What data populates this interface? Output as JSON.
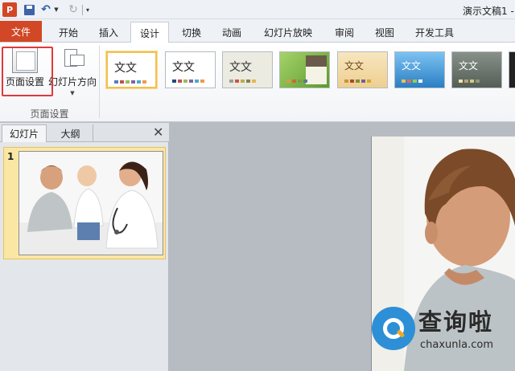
{
  "app": {
    "logo_letter": "P",
    "document_title": "演示文稿1 -"
  },
  "quick_access": {
    "save": "save-icon",
    "undo": "undo-icon",
    "redo": "redo-icon"
  },
  "tabs": {
    "file": "文件",
    "items": [
      {
        "label": "开始"
      },
      {
        "label": "插入"
      },
      {
        "label": "设计",
        "active": true
      },
      {
        "label": "切换"
      },
      {
        "label": "动画"
      },
      {
        "label": "幻灯片放映"
      },
      {
        "label": "审阅"
      },
      {
        "label": "视图"
      },
      {
        "label": "开发工具"
      }
    ]
  },
  "ribbon": {
    "page_setup_button": "页面设置",
    "slide_orientation_button": "幻灯片方向",
    "group_label": "页面设置",
    "themes": [
      {
        "label": "文文",
        "bg": "#ffffff"
      },
      {
        "label": "文文",
        "bg": "#ffffff"
      },
      {
        "label": "文文",
        "bg": "#ecebe1"
      },
      {
        "label": "",
        "bg": "#8cc04a"
      },
      {
        "label": "文文",
        "bg": "#f3deb1"
      },
      {
        "label": "文文",
        "bg": "#4a9fe0"
      },
      {
        "label": "文文",
        "bg": "#6f7b72"
      }
    ]
  },
  "left_panel": {
    "tab_slides": "幻灯片",
    "tab_outline": "大纲",
    "slide_number": "1"
  },
  "watermark": {
    "chinese": "查询啦",
    "domain": "chaxunla.com"
  },
  "colors": {
    "accent_file_tab": "#d24726",
    "selection_red": "#e0393b",
    "thumbnail_highlight": "#fbe7a4"
  }
}
